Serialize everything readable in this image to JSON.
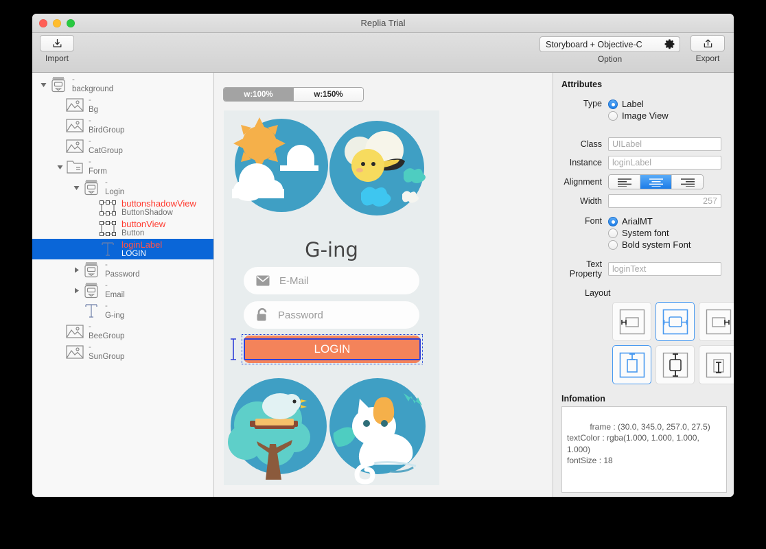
{
  "window": {
    "title": "Replia Trial",
    "traffic_lights": [
      "close-red",
      "minimize-yellow",
      "zoom-green"
    ]
  },
  "toolbar": {
    "import_label": "Import",
    "import_icon": "import-download-icon",
    "option_value": "Storyboard + Objective-C",
    "option_icon": "gear-icon",
    "option_label": "Option",
    "export_label": "Export",
    "export_icon": "export-share-icon"
  },
  "sidebar": {
    "items": [
      {
        "indent": 0,
        "twisty": "down",
        "icon": "view-controller-icon",
        "name": "-",
        "sub": "background",
        "selected": false,
        "red": false
      },
      {
        "indent": 1,
        "twisty": "none",
        "icon": "image-view-icon",
        "name": "-",
        "sub": "Bg",
        "selected": false,
        "red": false
      },
      {
        "indent": 1,
        "twisty": "none",
        "icon": "image-view-icon",
        "name": "-",
        "sub": "BirdGroup",
        "selected": false,
        "red": false
      },
      {
        "indent": 1,
        "twisty": "none",
        "icon": "image-view-icon",
        "name": "-",
        "sub": "CatGroup",
        "selected": false,
        "red": false
      },
      {
        "indent": 1,
        "twisty": "down",
        "icon": "folder-icon",
        "name": "-",
        "sub": "Form",
        "selected": false,
        "red": false
      },
      {
        "indent": 2,
        "twisty": "down",
        "icon": "view-controller-icon",
        "name": "-",
        "sub": "Login",
        "selected": false,
        "red": false
      },
      {
        "indent": 3,
        "twisty": "none",
        "icon": "selection-box-icon",
        "name": "buttonshadowView",
        "sub": "ButtonShadow",
        "selected": false,
        "red": true
      },
      {
        "indent": 3,
        "twisty": "none",
        "icon": "selection-box-icon",
        "name": "buttonView",
        "sub": "Button",
        "selected": false,
        "red": true
      },
      {
        "indent": 3,
        "twisty": "none",
        "icon": "text-label-icon",
        "name": "loginLabel",
        "sub": "LOGIN",
        "selected": true,
        "red": true
      },
      {
        "indent": 2,
        "twisty": "right",
        "icon": "view-controller-icon",
        "name": "-",
        "sub": "Password",
        "selected": false,
        "red": false
      },
      {
        "indent": 2,
        "twisty": "right",
        "icon": "view-controller-icon",
        "name": "-",
        "sub": "Email",
        "selected": false,
        "red": false
      },
      {
        "indent": 2,
        "twisty": "none",
        "icon": "text-label-icon",
        "name": "-",
        "sub": "G-ing",
        "selected": false,
        "red": false
      },
      {
        "indent": 1,
        "twisty": "none",
        "icon": "image-view-icon",
        "name": "-",
        "sub": "BeeGroup",
        "selected": false,
        "red": false
      },
      {
        "indent": 1,
        "twisty": "none",
        "icon": "image-view-icon",
        "name": "-",
        "sub": "SunGroup",
        "selected": false,
        "red": false
      }
    ]
  },
  "canvas": {
    "zoom_segments": [
      {
        "label": "w:100%",
        "selected": true
      },
      {
        "label": "w:150%",
        "selected": false
      }
    ],
    "preview": {
      "app_title": "G-ing",
      "email_placeholder": "E-Mail",
      "email_icon": "envelope-icon",
      "password_placeholder": "Password",
      "password_icon": "lock-icon",
      "login_button_label": "LOGIN",
      "login_button_color": "#f4835a",
      "background_color": "#e8edee",
      "selection_color": "#2f3fd8",
      "illustration_circle_color": "#3f9fc4"
    }
  },
  "attributes": {
    "section_title": "Attributes",
    "type_label": "Type",
    "type_options": [
      {
        "label": "Label",
        "selected": true
      },
      {
        "label": "Image View",
        "selected": false
      }
    ],
    "class_label": "Class",
    "class_value": "UILabel",
    "instance_label": "Instance",
    "instance_value": "loginLabel",
    "alignment_label": "Alignment",
    "alignment_options": [
      {
        "icon": "align-left-icon",
        "selected": false
      },
      {
        "icon": "align-center-icon",
        "selected": true
      },
      {
        "icon": "align-right-icon",
        "selected": false
      }
    ],
    "width_label": "Width",
    "width_value": "257",
    "font_label": "Font",
    "font_options": [
      {
        "label": "ArialMT",
        "selected": true
      },
      {
        "label": "System font",
        "selected": false
      },
      {
        "label": "Bold system Font",
        "selected": false
      }
    ],
    "text_property_label": "Text Property",
    "text_property_value": "loginText",
    "layout_label": "Layout",
    "layout_cells": [
      {
        "icon": "pin-horizontal-left-icon",
        "selected": false
      },
      {
        "icon": "pin-horizontal-both-icon",
        "selected": true
      },
      {
        "icon": "pin-horizontal-right-icon",
        "selected": false
      },
      {
        "icon": "pin-vertical-top-icon",
        "selected": true
      },
      {
        "icon": "pin-vertical-both-icon",
        "selected": false
      },
      {
        "icon": "pin-vertical-bottom-icon",
        "selected": false
      }
    ],
    "information_label": "Infomation",
    "information_text": "frame : (30.0, 345.0, 257.0, 27.5)\ntextColor : rgba(1.000, 1.000, 1.000, 1.000)\nfontSize : 18"
  }
}
